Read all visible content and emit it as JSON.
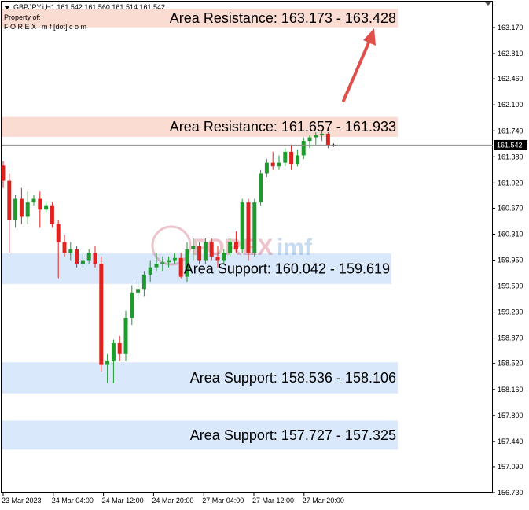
{
  "header": {
    "title_line": "GBPJPY.i,H1  161.542 161.560 161.514 161.542",
    "property_line": "Property of:",
    "owner_line": "F O R E X i m f [dot] c o m"
  },
  "watermark": {
    "part1": "FOREX",
    "part2": "imf"
  },
  "current_price_label": "161.542",
  "chart_data": {
    "type": "candlestick",
    "symbol": "GBPJPY.i",
    "timeframe": "H1",
    "ohlc_header": {
      "open": 161.542,
      "high": 161.56,
      "low": 161.514,
      "close": 161.542
    },
    "current_price": 161.542,
    "ylim": [
      156.73,
      163.53
    ],
    "y_ticks": [
      "163.170",
      "162.810",
      "162.460",
      "162.100",
      "161.740",
      "161.380",
      "161.020",
      "160.670",
      "160.310",
      "159.950",
      "159.590",
      "159.230",
      "158.870",
      "158.520",
      "158.160",
      "157.800",
      "157.440",
      "157.090",
      "156.730"
    ],
    "x_ticks": [
      "23 Mar 2023",
      "24 Mar 04:00",
      "24 Mar 12:00",
      "24 Mar 20:00",
      "27 Mar 04:00",
      "27 Mar 12:00",
      "27 Mar 20:00"
    ],
    "zones": [
      {
        "label": "Area Resistance: 163.173 - 163.428",
        "top": 163.428,
        "bottom": 163.173,
        "kind": "resistance"
      },
      {
        "label": "Area Resistance: 161.657 - 161.933",
        "top": 161.933,
        "bottom": 161.657,
        "kind": "resistance"
      },
      {
        "label": "Area Support: 160.042 - 159.619",
        "top": 160.042,
        "bottom": 159.619,
        "kind": "support"
      },
      {
        "label": "Area Support: 158.536 - 158.106",
        "top": 158.536,
        "bottom": 158.106,
        "kind": "support"
      },
      {
        "label": "Area Support: 157.727 - 157.325",
        "top": 157.727,
        "bottom": 157.325,
        "kind": "support"
      }
    ],
    "candles": [
      [
        161.26,
        161.32,
        160.95,
        161.05
      ],
      [
        161.05,
        161.15,
        160.05,
        160.5
      ],
      [
        160.5,
        160.85,
        160.4,
        160.8
      ],
      [
        160.8,
        160.95,
        160.45,
        160.55
      ],
      [
        160.55,
        160.9,
        160.45,
        160.75
      ],
      [
        160.75,
        160.85,
        160.7,
        160.8
      ],
      [
        160.8,
        160.9,
        160.4,
        160.65
      ],
      [
        160.65,
        160.75,
        160.6,
        160.7
      ],
      [
        160.7,
        160.75,
        160.4,
        160.45
      ],
      [
        160.45,
        160.5,
        159.7,
        160.2
      ],
      [
        160.2,
        160.3,
        160.0,
        160.05
      ],
      [
        160.05,
        160.2,
        159.95,
        160.1
      ],
      [
        160.1,
        160.15,
        159.85,
        159.9
      ],
      [
        159.9,
        160.05,
        159.85,
        159.95
      ],
      [
        159.95,
        160.1,
        159.9,
        160.05
      ],
      [
        160.05,
        160.15,
        159.85,
        159.9
      ],
      [
        159.9,
        160.0,
        158.4,
        158.5
      ],
      [
        158.5,
        158.65,
        158.25,
        158.55
      ],
      [
        158.55,
        158.85,
        158.25,
        158.8
      ],
      [
        158.8,
        158.9,
        158.55,
        158.65
      ],
      [
        158.65,
        159.25,
        158.55,
        159.15
      ],
      [
        159.15,
        159.6,
        159.05,
        159.5
      ],
      [
        159.5,
        159.65,
        159.4,
        159.55
      ],
      [
        159.55,
        159.8,
        159.45,
        159.75
      ],
      [
        159.75,
        159.95,
        159.65,
        159.85
      ],
      [
        159.85,
        160.05,
        159.8,
        159.9
      ],
      [
        159.9,
        160.0,
        159.8,
        159.92
      ],
      [
        159.92,
        160.0,
        159.85,
        159.95
      ],
      [
        159.95,
        160.05,
        159.9,
        159.98
      ],
      [
        159.98,
        160.05,
        159.7,
        159.72
      ],
      [
        159.72,
        160.2,
        159.65,
        160.1
      ],
      [
        160.1,
        160.25,
        159.95,
        160.15
      ],
      [
        160.15,
        160.2,
        159.9,
        159.95
      ],
      [
        159.95,
        160.25,
        159.9,
        160.2
      ],
      [
        160.2,
        160.25,
        159.95,
        160.0
      ],
      [
        160.0,
        160.15,
        159.85,
        159.95
      ],
      [
        159.95,
        160.1,
        159.9,
        160.05
      ],
      [
        160.05,
        160.25,
        160.0,
        160.2
      ],
      [
        160.2,
        160.35,
        160.05,
        160.1
      ],
      [
        160.1,
        160.8,
        160.05,
        160.75
      ],
      [
        160.75,
        160.8,
        159.95,
        160.05
      ],
      [
        160.05,
        160.8,
        160.0,
        160.75
      ],
      [
        160.75,
        161.2,
        160.7,
        161.15
      ],
      [
        161.15,
        161.35,
        161.1,
        161.3
      ],
      [
        161.3,
        161.45,
        161.2,
        161.25
      ],
      [
        161.25,
        161.4,
        161.2,
        161.3
      ],
      [
        161.3,
        161.5,
        161.25,
        161.45
      ],
      [
        161.45,
        161.55,
        161.2,
        161.28
      ],
      [
        161.28,
        161.48,
        161.25,
        161.4
      ],
      [
        161.4,
        161.65,
        161.35,
        161.6
      ],
      [
        161.6,
        161.68,
        161.5,
        161.65
      ],
      [
        161.65,
        161.72,
        161.55,
        161.68
      ],
      [
        161.68,
        161.74,
        161.6,
        161.7
      ],
      [
        161.7,
        161.72,
        161.5,
        161.54
      ]
    ]
  },
  "colors": {
    "bull": "#1f9a2f",
    "bear": "#e0221f",
    "resistance_fill": "#fbdcd2",
    "support_fill": "#d9e9fb",
    "arrow": "#e0504a",
    "price_tag_bg": "#000000",
    "grid_line": "#000000"
  }
}
